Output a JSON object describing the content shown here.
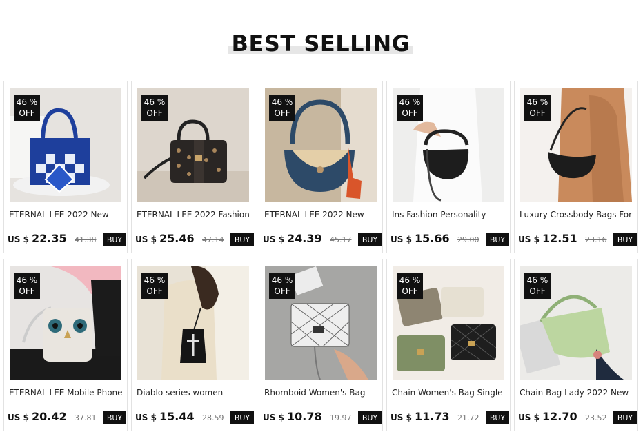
{
  "header": {
    "title": "BEST SELLING"
  },
  "currency": "US $",
  "buy_label": "BUY",
  "badge": {
    "percent": "46 %",
    "off": "OFF"
  },
  "products": [
    {
      "name": "ETERNAL LEE 2022 New",
      "price": "22.35",
      "old_price": "41.38"
    },
    {
      "name": "ETERNAL LEE 2022 Fashion",
      "price": "25.46",
      "old_price": "47.14"
    },
    {
      "name": "ETERNAL LEE 2022 New",
      "price": "24.39",
      "old_price": "45.17"
    },
    {
      "name": "Ins Fashion Personality",
      "price": "15.66",
      "old_price": "29.00"
    },
    {
      "name": "Luxury Crossbody Bags For",
      "price": "12.51",
      "old_price": "23.16"
    },
    {
      "name": "ETERNAL LEE Mobile Phone",
      "price": "20.42",
      "old_price": "37.81"
    },
    {
      "name": "Diablo series women",
      "price": "15.44",
      "old_price": "28.59"
    },
    {
      "name": "Rhomboid Women's Bag",
      "price": "10.78",
      "old_price": "19.97"
    },
    {
      "name": "Chain Women's Bag Single",
      "price": "11.73",
      "old_price": "21.72"
    },
    {
      "name": "Chain Bag Lady 2022 New",
      "price": "12.70",
      "old_price": "23.52"
    }
  ]
}
